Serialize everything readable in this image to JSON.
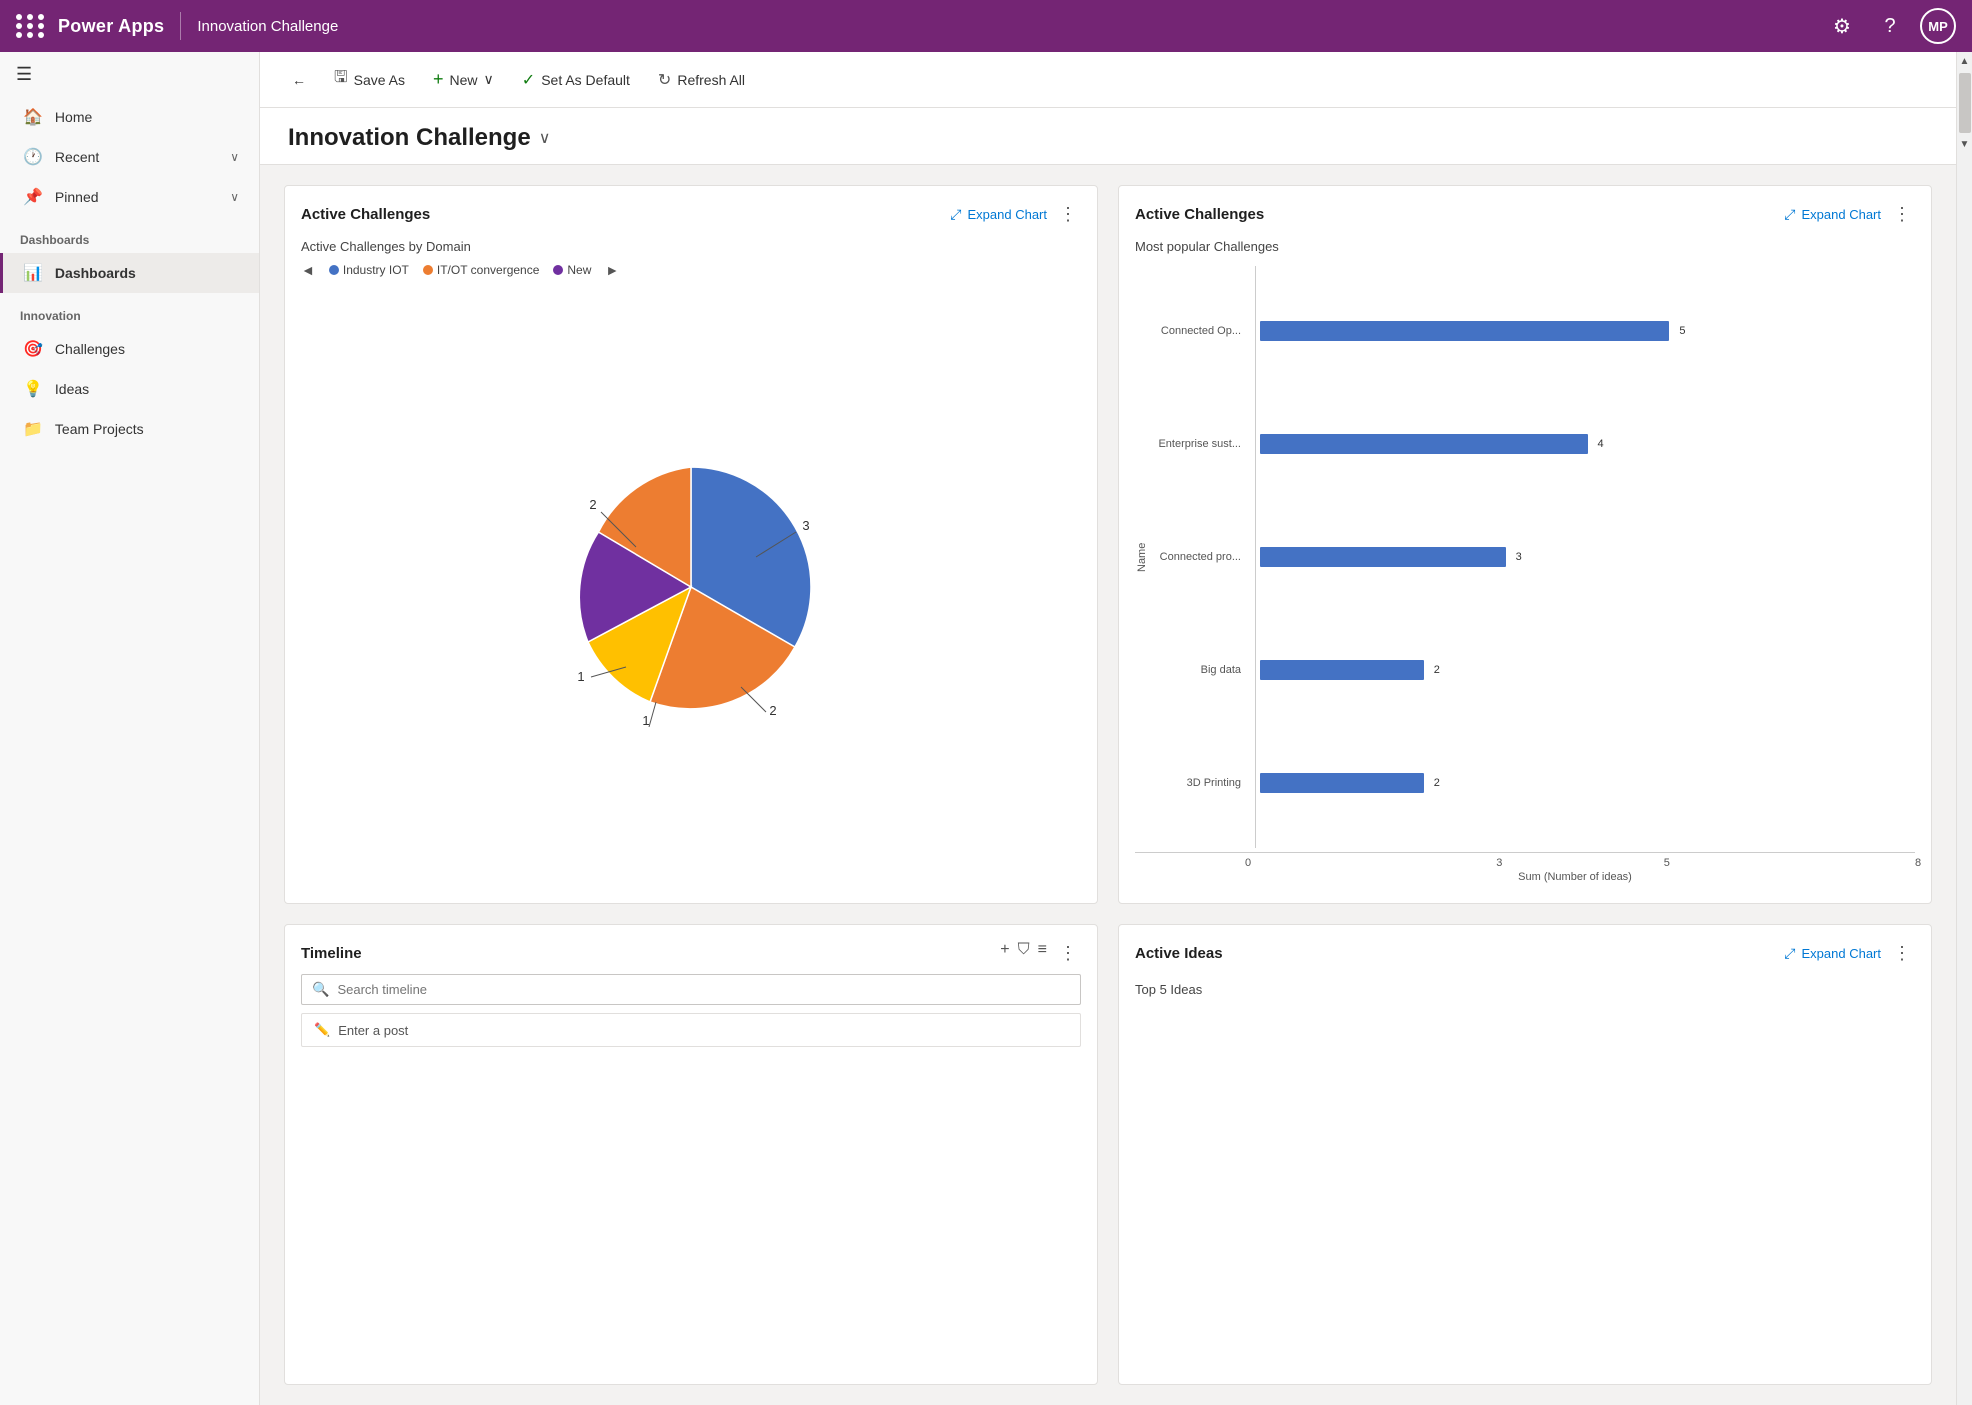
{
  "topNav": {
    "brand": "Power Apps",
    "appName": "Innovation Challenge",
    "avatarInitials": "MP"
  },
  "toolbar": {
    "backLabel": "←",
    "saveAsLabel": "Save As",
    "newLabel": "New",
    "setAsDefaultLabel": "Set As Default",
    "refreshAllLabel": "Refresh All"
  },
  "pageTitle": "Innovation Challenge",
  "sidebar": {
    "sections": [
      {
        "items": [
          {
            "label": "Home",
            "icon": "🏠",
            "active": false
          },
          {
            "label": "Recent",
            "icon": "🕐",
            "active": false,
            "hasChevron": true
          },
          {
            "label": "Pinned",
            "icon": "📌",
            "active": false,
            "hasChevron": true
          }
        ]
      },
      {
        "heading": "Dashboards",
        "items": [
          {
            "label": "Dashboards",
            "icon": "📊",
            "active": true
          }
        ]
      },
      {
        "heading": "Innovation",
        "items": [
          {
            "label": "Challenges",
            "icon": "🎯",
            "active": false
          },
          {
            "label": "Ideas",
            "icon": "💡",
            "active": false
          },
          {
            "label": "Team Projects",
            "icon": "📁",
            "active": false
          }
        ]
      }
    ]
  },
  "cards": {
    "activeChallenges1": {
      "title": "Active Challenges",
      "expandLabel": "Expand Chart",
      "subtitle": "Active Challenges by Domain",
      "legendItems": [
        {
          "label": "Industry IOT",
          "color": "#4472c4"
        },
        {
          "label": "IT/OT convergence",
          "color": "#ed7d31"
        },
        {
          "label": "New",
          "color": "#7030a0"
        }
      ],
      "pieData": [
        {
          "label": "3",
          "value": 3,
          "color": "#4472c4",
          "angle": 108
        },
        {
          "label": "2",
          "value": 2,
          "color": "#ed7d31",
          "angle": 72
        },
        {
          "label": "1",
          "value": 1,
          "color": "#ffc000",
          "angle": 36
        },
        {
          "label": "1",
          "value": 1,
          "color": "#7030a0",
          "angle": 36
        },
        {
          "label": "2",
          "value": 2,
          "color": "#ed7d31",
          "angle": 72
        }
      ]
    },
    "activeChallenges2": {
      "title": "Active Challenges",
      "expandLabel": "Expand Chart",
      "subtitle": "Most popular Challenges",
      "yAxisLabel": "Name",
      "xAxisLabel": "Sum (Number of ideas)",
      "bars": [
        {
          "label": "Connected Op...",
          "value": 5,
          "maxValue": 8
        },
        {
          "label": "Enterprise sust...",
          "value": 4,
          "maxValue": 8
        },
        {
          "label": "Connected pro...",
          "value": 3,
          "maxValue": 8
        },
        {
          "label": "Big data",
          "value": 2,
          "maxValue": 8
        },
        {
          "label": "3D Printing",
          "value": 2,
          "maxValue": 8
        }
      ],
      "xAxisTicks": [
        "0",
        "3",
        "5",
        "8"
      ]
    },
    "timeline": {
      "title": "Timeline",
      "searchPlaceholder": "Search timeline",
      "postPlaceholder": "Enter a post"
    },
    "activeIdeas": {
      "title": "Active Ideas",
      "expandLabel": "Expand Chart",
      "subtitle": "Top 5 Ideas"
    }
  }
}
